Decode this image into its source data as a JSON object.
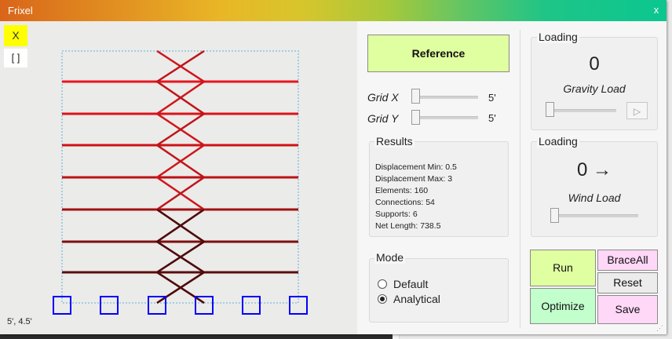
{
  "window": {
    "title": "Frixel",
    "close_label": "x"
  },
  "toolbar": {
    "x_label": "X",
    "brackets_label": "[ ]"
  },
  "canvas": {
    "coords": "5', 4.5'"
  },
  "reference": {
    "label": "Reference"
  },
  "grid": {
    "x": {
      "label": "Grid X",
      "value": "5'"
    },
    "y": {
      "label": "Grid Y",
      "value": "5'"
    }
  },
  "results": {
    "title": "Results",
    "lines": [
      "Displacement Min: 0.5",
      "Displacement Max: 3",
      "Elements: 160",
      "Connections: 54",
      "Supports: 6",
      "Net Length: 738.5"
    ]
  },
  "mode": {
    "title": "Mode",
    "options": [
      {
        "label": "Default",
        "selected": false
      },
      {
        "label": "Analytical",
        "selected": true
      }
    ]
  },
  "gravity": {
    "title": "Loading",
    "value": "0",
    "label": "Gravity Load",
    "play_icon": "play-icon"
  },
  "wind": {
    "title": "Loading",
    "value": "0 →",
    "label": "Wind Load"
  },
  "buttons": {
    "run": "Run",
    "brace_all": "BraceAll",
    "reset": "Reset",
    "optimize": "Optimize",
    "save": "Save"
  },
  "colors": {
    "run_bg": "#e0ffa0",
    "optimize_bg": "#c2ffcc",
    "brace_bg": "#ffd7f7",
    "save_bg": "#ffd7f7",
    "reset_bg": "#ececec",
    "support": "#0000ff",
    "frame_top": "#e8141e",
    "frame_bottom": "#3a0d0d"
  }
}
